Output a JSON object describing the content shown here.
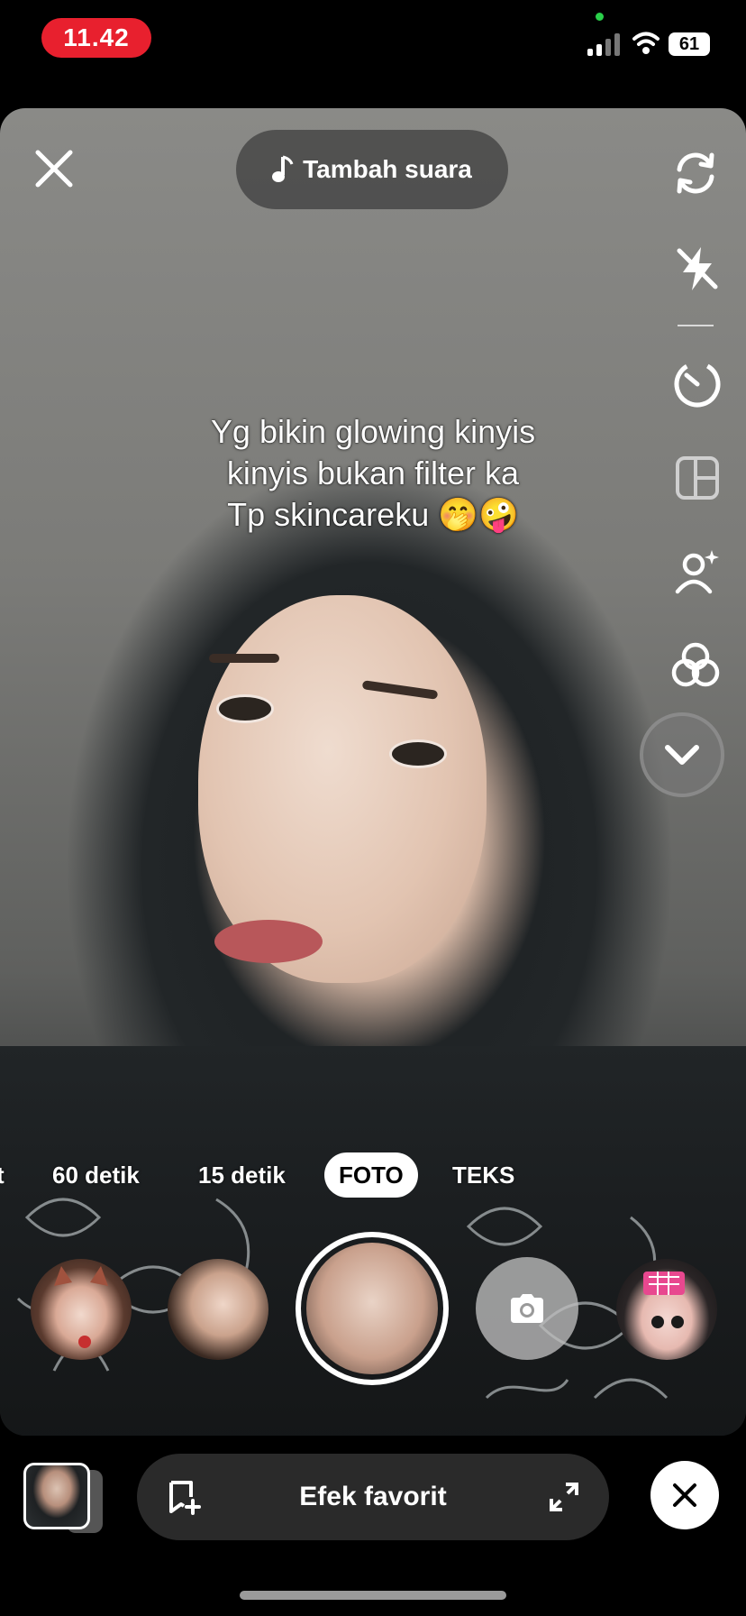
{
  "status_bar": {
    "time": "11.42",
    "battery": "61",
    "signal_bars": 2,
    "recording_indicator_color": "#2ad04a"
  },
  "camera": {
    "add_sound_label": "Tambah suara",
    "caption_lines": [
      "Yg bikin glowing kinyis",
      "kinyis bukan filter ka",
      "Tp skincareku 🤭🤪"
    ],
    "side_tools": [
      "flip-camera-icon",
      "flash-off-icon",
      "timer-icon",
      "layout-icon",
      "beauty-retouch-icon",
      "filters-icon",
      "collapse-icon"
    ],
    "modes": [
      {
        "label": "t"
      },
      {
        "label": "60 detik"
      },
      {
        "label": "15 detik"
      },
      {
        "label": "FOTO",
        "active": true
      },
      {
        "label": "TEKS"
      }
    ],
    "effects": [
      "cat-ears-effect",
      "glam-face-effect",
      "selected-beauty-effect",
      "camera-capture",
      "pink-cart-effect"
    ]
  },
  "bottom_bar": {
    "favorites_label": "Efek favorit"
  },
  "colors": {
    "time_pill": "#e8202e",
    "accent_white": "#ffffff",
    "pill_bg": "#2a2a2a"
  }
}
